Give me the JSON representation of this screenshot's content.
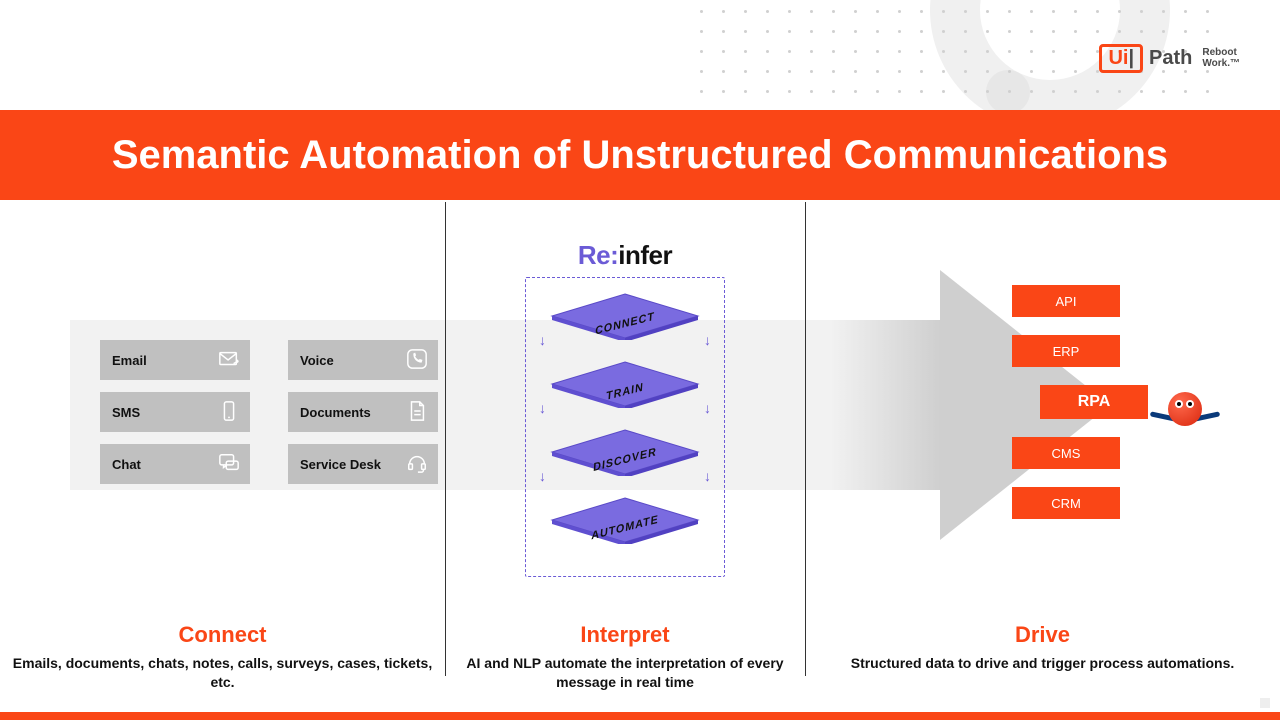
{
  "brand": {
    "ui": "Ui",
    "path": "Path",
    "tagline_l1": "Reboot",
    "tagline_l2": "Work.™"
  },
  "title": "Semantic Automation of Unstructured Communications",
  "connect": {
    "items": [
      {
        "label": "Email",
        "icon": "mail-icon"
      },
      {
        "label": "Voice",
        "icon": "phone-icon"
      },
      {
        "label": "SMS",
        "icon": "mobile-icon"
      },
      {
        "label": "Documents",
        "icon": "document-icon"
      },
      {
        "label": "Chat",
        "icon": "chat-icon"
      },
      {
        "label": "Service Desk",
        "icon": "headset-icon"
      }
    ]
  },
  "interpret": {
    "logo_re": "Re:",
    "logo_infer": "infer",
    "layers": [
      "CONNECT",
      "TRAIN",
      "DISCOVER",
      "AUTOMATE"
    ]
  },
  "drive": {
    "targets": [
      "API",
      "ERP",
      "RPA",
      "CMS",
      "CRM"
    ]
  },
  "captions": {
    "connect_h": "Connect",
    "connect_p": "Emails, documents, chats, notes, calls, surveys, cases, tickets, etc.",
    "interpret_h": "Interpret",
    "interpret_p": "AI and NLP automate the interpretation of every message in real time",
    "drive_h": "Drive",
    "drive_p": "Structured data to drive and trigger process automations."
  },
  "colors": {
    "accent": "#fa4616",
    "purple": "#6b5bd6"
  }
}
